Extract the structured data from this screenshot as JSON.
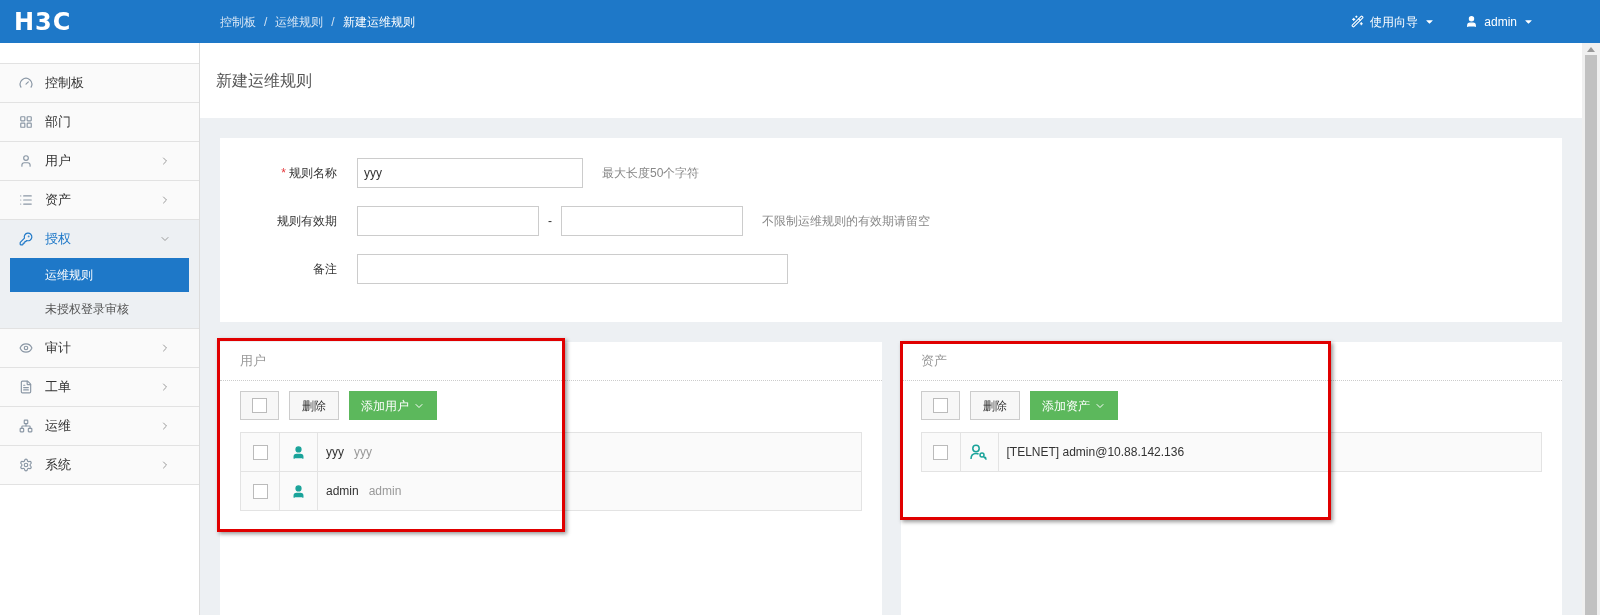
{
  "header": {
    "logo": "H3C",
    "breadcrumb": [
      {
        "label": "控制板",
        "current": false
      },
      {
        "label": "运维规则",
        "current": false
      },
      {
        "label": "新建运维规则",
        "current": true
      }
    ],
    "breadcrumb_separator": "/",
    "guide_menu": "使用向导",
    "user_menu": "admin"
  },
  "sidebar": {
    "items": [
      {
        "label": "控制板"
      },
      {
        "label": "部门"
      },
      {
        "label": "用户",
        "expanded": false
      },
      {
        "label": "资产",
        "expanded": false
      },
      {
        "label": "授权",
        "expanded": true,
        "children": [
          {
            "label": "运维规则",
            "selected": true
          },
          {
            "label": "未授权登录审核",
            "selected": false
          }
        ]
      },
      {
        "label": "审计",
        "expanded": false
      },
      {
        "label": "工单",
        "expanded": false
      },
      {
        "label": "运维",
        "expanded": false
      },
      {
        "label": "系统",
        "expanded": false
      }
    ]
  },
  "page_title": "新建运维规则",
  "form": {
    "required_mark": "*",
    "fields": [
      {
        "kind": "text",
        "label": "规则名称",
        "required": true,
        "value": "yyy",
        "hint": "最大长度50个字符"
      },
      {
        "kind": "range",
        "label": "规则有效期",
        "required": false,
        "separator": "-",
        "hint": "不限制运维规则的有效期请留空"
      },
      {
        "kind": "wide",
        "label": "备注",
        "required": false
      }
    ]
  },
  "panels": [
    {
      "kind": "user",
      "title": "用户",
      "select_all_checked": false,
      "delete_label": "删除",
      "add_label": "添加用户",
      "rows": [
        {
          "checked": false,
          "name": "yyy",
          "detail": "yyy"
        },
        {
          "checked": false,
          "name": "admin",
          "detail": "admin"
        }
      ]
    },
    {
      "kind": "asset",
      "title": "资产",
      "select_all_checked": false,
      "delete_label": "删除",
      "add_label": "添加资产",
      "rows": [
        {
          "checked": false,
          "name": "[TELNET] admin@10.88.142.136"
        }
      ]
    }
  ],
  "annotations": [
    {
      "kind": "highlight"
    },
    {
      "kind": "highlight"
    }
  ]
}
